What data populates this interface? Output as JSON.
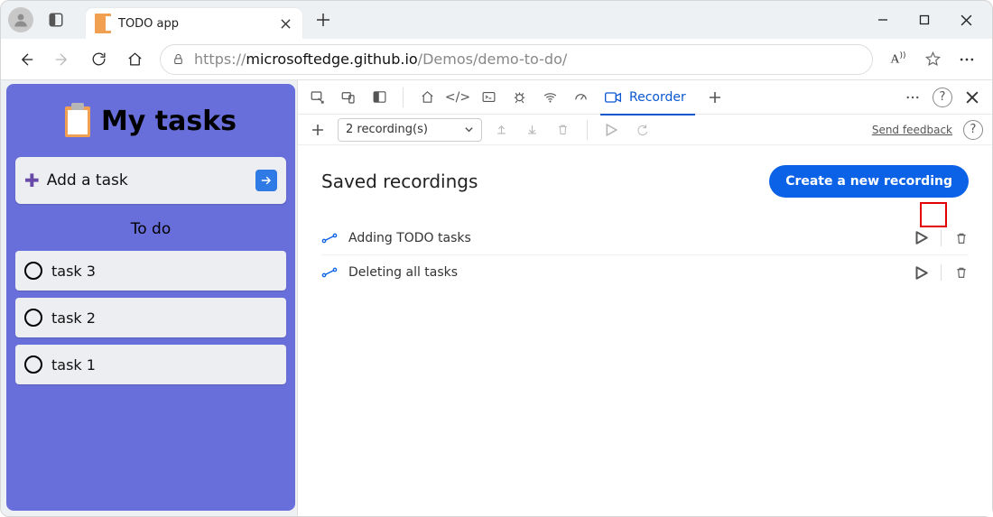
{
  "browser": {
    "tab_title": "TODO app",
    "url_host": "microsoftedge.github.io",
    "url_path": "/Demos/demo-to-do/",
    "url_proto": "https://"
  },
  "todo": {
    "title": "My tasks",
    "add_placeholder": "Add a task",
    "section_label": "To do",
    "tasks": [
      "task 3",
      "task 2",
      "task 1"
    ]
  },
  "devtools": {
    "active_panel": "Recorder",
    "recordings_selector": "2 recording(s)",
    "send_feedback": "Send feedback",
    "heading": "Saved recordings",
    "create_button": "Create a new recording",
    "recordings": [
      {
        "name": "Adding TODO tasks"
      },
      {
        "name": "Deleting all tasks"
      }
    ]
  }
}
